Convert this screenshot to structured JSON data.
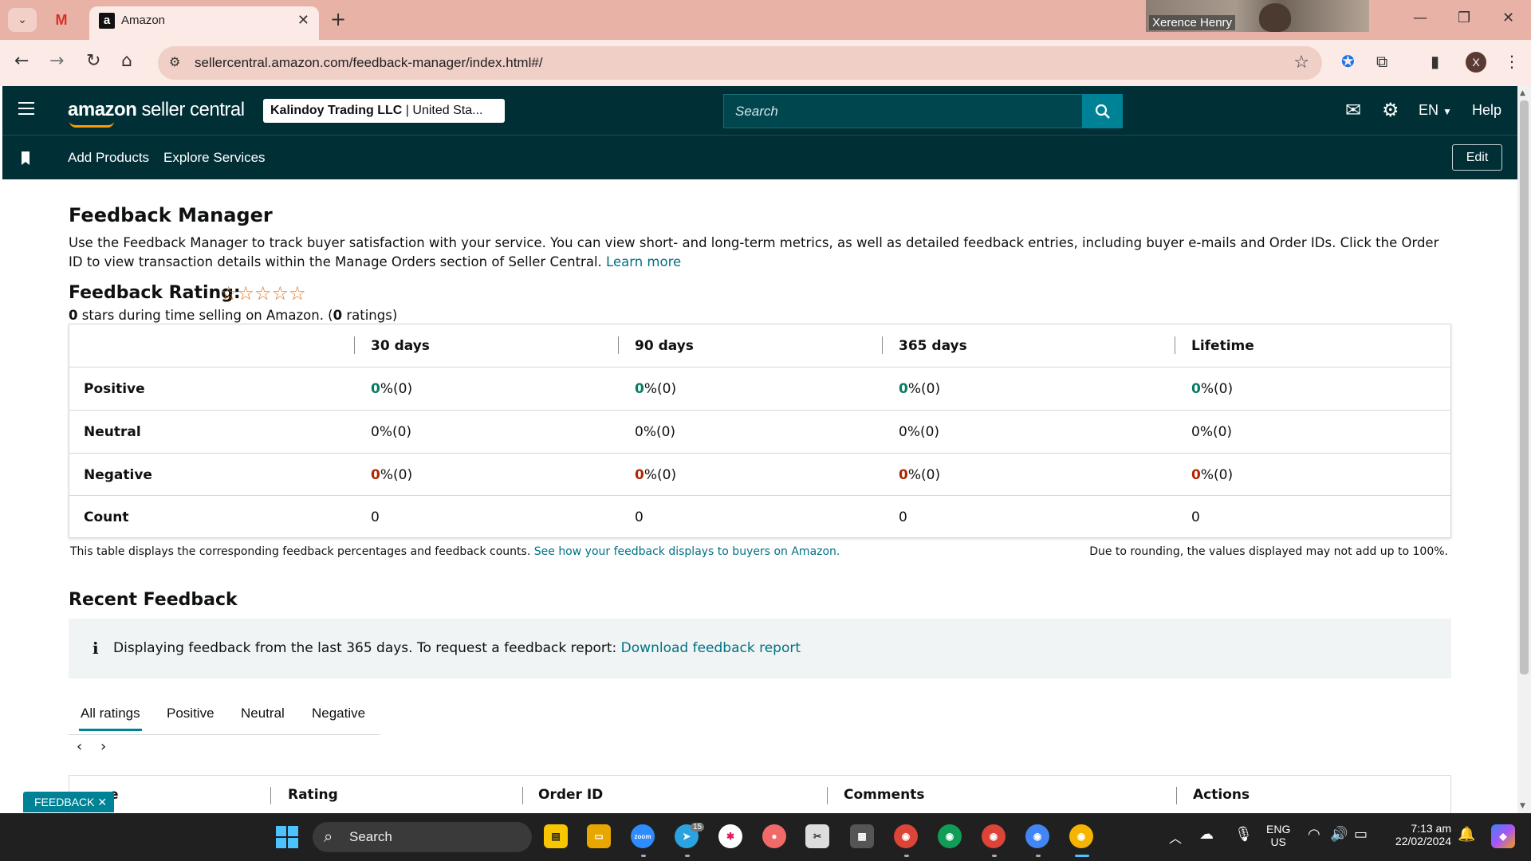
{
  "browser": {
    "tab_title": "Amazon",
    "url": "sellercentral.amazon.com/feedback-manager/index.html#/",
    "webcam_name": "Xerence Henry",
    "profile_initial": "X"
  },
  "header": {
    "logo_main": "amazon",
    "logo_sub": " seller central",
    "store_name": "Kalindoy Trading LLC",
    "store_region": " | United Sta...",
    "search_placeholder": "Search",
    "language": "EN",
    "help": "Help"
  },
  "nav": {
    "items": [
      "Add Products",
      "Explore Services"
    ],
    "edit": "Edit"
  },
  "page": {
    "title": "Feedback Manager",
    "intro": "Use the Feedback Manager to track buyer satisfaction with your service. You can view short- and long-term metrics, as well as detailed feedback entries, including buyer e-mails and Order IDs. Click the Order ID to view transaction details within the Manage Orders section of Seller Central.",
    "learn_more": "Learn more",
    "rating_label": "Feedback Rating:",
    "stars": 0,
    "stars_max": 5,
    "stars_text": "☆☆☆☆☆",
    "rating_sub_stars": "0",
    "rating_sub_mid": " stars during time selling on Amazon. (",
    "rating_sub_count": "0",
    "rating_sub_end": " ratings)"
  },
  "feedback_table": {
    "columns": [
      "30 days",
      "90 days",
      "365 days",
      "Lifetime"
    ],
    "rows": [
      {
        "label": "Positive",
        "values": [
          "0",
          "0",
          "0",
          "0"
        ],
        "suffix": " %(0)"
      },
      {
        "label": "Neutral",
        "values": [
          "0",
          "0",
          "0",
          "0"
        ],
        "suffix": " %(0)"
      },
      {
        "label": "Negative",
        "values": [
          "0",
          "0",
          "0",
          "0"
        ],
        "suffix": " %(0)"
      },
      {
        "label": "Count",
        "values": [
          "0",
          "0",
          "0",
          "0"
        ],
        "suffix": ""
      }
    ],
    "note": "This table displays the corresponding feedback percentages and feedback counts.",
    "note_link": "See how your feedback displays to buyers on Amazon.",
    "note_right": "Due to rounding, the values displayed may not add up to 100%."
  },
  "recent": {
    "title": "Recent Feedback",
    "info_icon": "i",
    "info_text": "Displaying feedback from the last 365 days. To request a feedback report: ",
    "info_link": "Download feedback report",
    "tabs": [
      "All ratings",
      "Positive",
      "Neutral",
      "Negative"
    ],
    "pager_prev": "‹",
    "pager_next": "›",
    "columns": [
      "e",
      "Rating",
      "Order ID",
      "Comments",
      "Actions"
    ]
  },
  "feedback_widget": "FEEDBACK ✕",
  "taskbar": {
    "search": "Search",
    "lang_top": "ENG",
    "lang_bottom": "US",
    "time": "7:13 am",
    "date": "22/02/2024",
    "telegram_badge": "15"
  },
  "colors": {
    "header_bg": "#002f36",
    "accent": "#008296",
    "link": "#007185",
    "positive": "#067d62",
    "negative": "#b12704",
    "star": "#de7921"
  }
}
